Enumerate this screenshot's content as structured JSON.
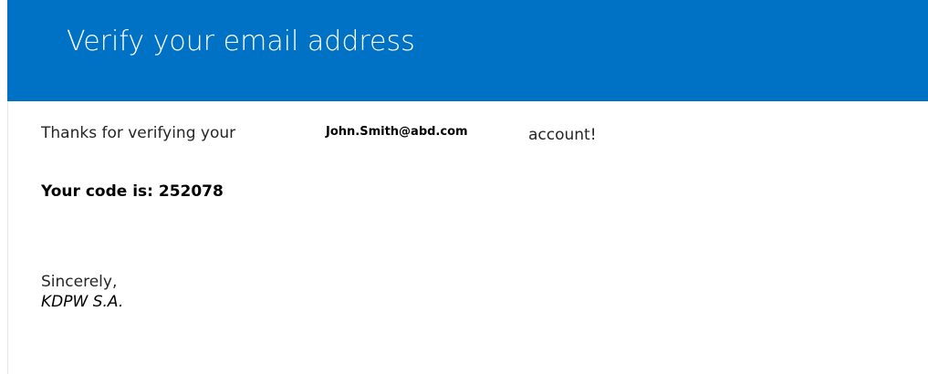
{
  "header": {
    "title": "Verify your email address",
    "background_color": "#0072c6",
    "text_color": "#ffffff"
  },
  "message": {
    "thanks_prefix": "Thanks for verifying your",
    "email_address": "John.Smith@abd.com",
    "thanks_suffix": "account!",
    "code_line": "Your code is: 252078"
  },
  "signature": {
    "signoff": "Sincerely,",
    "sender": "KDPW S.A."
  }
}
